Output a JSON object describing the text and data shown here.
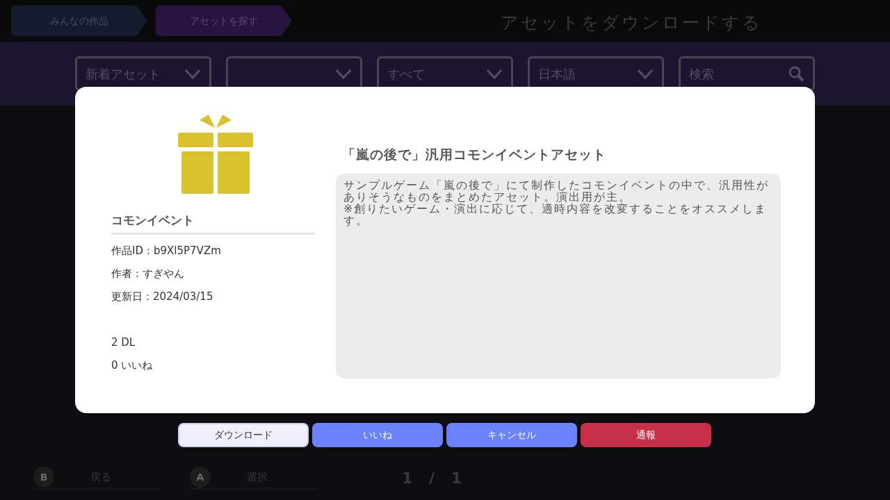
{
  "breadcrumbs": [
    {
      "label": "みんなの作品",
      "selected": false
    },
    {
      "label": "アセットを探す",
      "selected": true
    }
  ],
  "page_title": "アセットをダウンロードする",
  "filters": [
    {
      "kind": "dropdown",
      "value": "新着アセット"
    },
    {
      "kind": "dropdown"
    },
    {
      "kind": "dropdown",
      "value": "すべて"
    },
    {
      "kind": "dropdown",
      "value": "日本語"
    },
    {
      "kind": "search",
      "placeholder": "検索"
    }
  ],
  "dialog": {
    "category": "コモンイベント",
    "info": [
      "作品ID：b9Xl5P7VZm",
      "作者：すぎやん",
      "更新日：2024/03/15"
    ],
    "stats": [
      "2 DL",
      "0 いいね"
    ],
    "title": "「嵐の後で」汎用コモンイベントアセット",
    "description": "サンプルゲーム「嵐の後で」にて制作したコモンイベントの中で、汎用性がありそうなものをまとめたアセット。演出用が主。\n※創りたいゲーム・演出に応じて、適時内容を改変することをオススメします。"
  },
  "buttons": [
    {
      "label": "ダウンロード",
      "kind": "default",
      "selected": true
    },
    {
      "label": "いいね",
      "kind": "default",
      "selected": false
    },
    {
      "label": "キャンセル",
      "kind": "default",
      "selected": false
    },
    {
      "label": "通報",
      "kind": "danger",
      "selected": false
    }
  ],
  "footer": {
    "hints": [
      {
        "key": "B",
        "label": "戻る"
      },
      {
        "key": "A",
        "label": "選択"
      }
    ],
    "page": "1 / 1"
  }
}
